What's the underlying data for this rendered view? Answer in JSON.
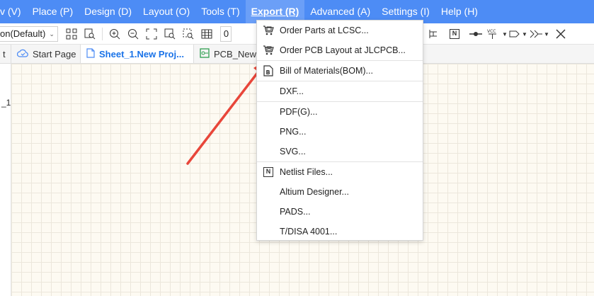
{
  "menubar": {
    "items": [
      "v (V)",
      "Place (P)",
      "Design (D)",
      "Layout (O)",
      "Tools (T)",
      "Export (R)",
      "Advanced (A)",
      "Settings (I)",
      "Help (H)"
    ],
    "active": "Export (R)"
  },
  "toolbar": {
    "view_combo": "on(Default)",
    "zoom_value": "0"
  },
  "tabs": [
    {
      "label": "t",
      "icon": ""
    },
    {
      "label": "Start Page",
      "icon": "cloud-icon"
    },
    {
      "label": "Sheet_1.New Proj...",
      "icon": "document-icon"
    },
    {
      "label": "PCB_New",
      "icon": "pcb-icon"
    }
  ],
  "canvas": {
    "side_label": "_1"
  },
  "export_menu": {
    "items": [
      {
        "label": "Order Parts at LCSC...",
        "icon": "cart-icon"
      },
      {
        "label": "Order PCB Layout at JLCPCB...",
        "icon": "pcb-cart-icon"
      },
      {
        "label": "Bill of Materials(BOM)...",
        "icon": "bom-icon"
      },
      {
        "label": "DXF...",
        "icon": ""
      },
      {
        "label": "PDF(G)...",
        "icon": ""
      },
      {
        "label": "PNG...",
        "icon": ""
      },
      {
        "label": "SVG...",
        "icon": ""
      },
      {
        "label": "Netlist Files...",
        "icon": "netlist-icon"
      },
      {
        "label": "Altium Designer...",
        "icon": ""
      },
      {
        "label": "PADS...",
        "icon": ""
      },
      {
        "label": "T/DISA 4001...",
        "icon": ""
      }
    ]
  },
  "annotation": {
    "arrow_color": "#e8463a"
  },
  "colors": {
    "menubar": "#4d8cf5",
    "active_tab_text": "#1a73e8"
  }
}
